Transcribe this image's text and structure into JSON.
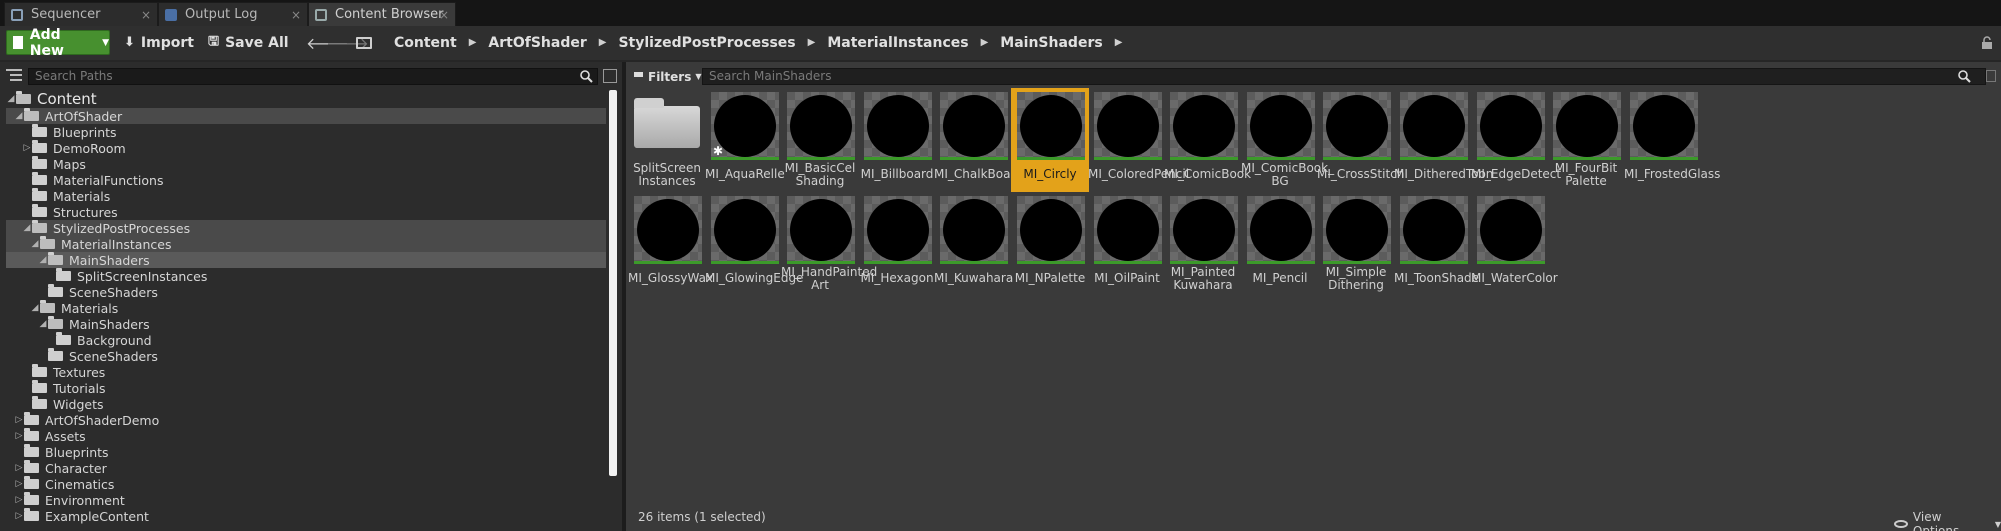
{
  "tabs": [
    {
      "label": "Sequencer",
      "icon": "sequencer-icon"
    },
    {
      "label": "Output Log",
      "icon": "output-log-icon"
    },
    {
      "label": "Content Browser",
      "icon": "content-browser-icon",
      "active": true
    }
  ],
  "toolbar": {
    "add_new": "Add New",
    "import": "Import",
    "save_all": "Save All",
    "breadcrumbs": [
      "Content",
      "ArtOfShader",
      "StylizedPostProcesses",
      "MaterialInstances",
      "MainShaders"
    ]
  },
  "sidebar": {
    "search_placeholder": "Search Paths",
    "tree": [
      {
        "label": "Content",
        "depth": 0,
        "expander": "open",
        "root": true
      },
      {
        "label": "ArtOfShader",
        "depth": 1,
        "expander": "open",
        "highlight": true
      },
      {
        "label": "Blueprints",
        "depth": 2,
        "expander": ""
      },
      {
        "label": "DemoRoom",
        "depth": 2,
        "expander": "closed"
      },
      {
        "label": "Maps",
        "depth": 2,
        "expander": ""
      },
      {
        "label": "MaterialFunctions",
        "depth": 2,
        "expander": ""
      },
      {
        "label": "Materials",
        "depth": 2,
        "expander": ""
      },
      {
        "label": "Structures",
        "depth": 2,
        "expander": ""
      },
      {
        "label": "StylizedPostProcesses",
        "depth": 2,
        "expander": "open",
        "highlight": true
      },
      {
        "label": "MaterialInstances",
        "depth": 3,
        "expander": "open",
        "highlight": true
      },
      {
        "label": "MainShaders",
        "depth": 4,
        "expander": "open",
        "selected": true
      },
      {
        "label": "SplitScreenInstances",
        "depth": 5,
        "expander": ""
      },
      {
        "label": "SceneShaders",
        "depth": 4,
        "expander": ""
      },
      {
        "label": "Materials",
        "depth": 3,
        "expander": "open"
      },
      {
        "label": "MainShaders",
        "depth": 4,
        "expander": "open"
      },
      {
        "label": "Background",
        "depth": 5,
        "expander": ""
      },
      {
        "label": "SceneShaders",
        "depth": 4,
        "expander": ""
      },
      {
        "label": "Textures",
        "depth": 2,
        "expander": ""
      },
      {
        "label": "Tutorials",
        "depth": 2,
        "expander": ""
      },
      {
        "label": "Widgets",
        "depth": 2,
        "expander": ""
      },
      {
        "label": "ArtOfShaderDemo",
        "depth": 1,
        "expander": "closed"
      },
      {
        "label": "Assets",
        "depth": 1,
        "expander": "closed"
      },
      {
        "label": "Blueprints",
        "depth": 1,
        "expander": ""
      },
      {
        "label": "Character",
        "depth": 1,
        "expander": "closed"
      },
      {
        "label": "Cinematics",
        "depth": 1,
        "expander": "closed"
      },
      {
        "label": "Environment",
        "depth": 1,
        "expander": "closed"
      },
      {
        "label": "ExampleContent",
        "depth": 1,
        "expander": "closed"
      }
    ]
  },
  "main": {
    "filters_label": "Filters",
    "search_placeholder": "Search MainShaders",
    "assets": [
      {
        "label": "SplitScreen\nInstances",
        "kind": "folder"
      },
      {
        "label": "MI_AquaRelle",
        "kind": "material",
        "starred": true
      },
      {
        "label": "MI_BasicCel\nShading",
        "kind": "material"
      },
      {
        "label": "MI_Billboard",
        "kind": "material"
      },
      {
        "label": "MI_ChalkBoard",
        "kind": "material"
      },
      {
        "label": "MI_Circly",
        "kind": "material",
        "selected": true
      },
      {
        "label": "MI_ColoredPencil",
        "kind": "material"
      },
      {
        "label": "MI_ComicBook",
        "kind": "material"
      },
      {
        "label": "MI_ComicBook_\nBG",
        "kind": "material"
      },
      {
        "label": "MI_CrossStitch",
        "kind": "material"
      },
      {
        "label": "MI_DitheredToon",
        "kind": "material"
      },
      {
        "label": "MI_EdgeDetect",
        "kind": "material"
      },
      {
        "label": "MI_FourBit\nPalette",
        "kind": "material"
      },
      {
        "label": "MI_FrostedGlass",
        "kind": "material"
      },
      {
        "label": "MI_GlossyWax",
        "kind": "material"
      },
      {
        "label": "MI_GlowingEdge",
        "kind": "material"
      },
      {
        "label": "MI_HandPainted\nArt",
        "kind": "material"
      },
      {
        "label": "MI_Hexagon",
        "kind": "material"
      },
      {
        "label": "MI_Kuwahara",
        "kind": "material"
      },
      {
        "label": "MI_NPalette",
        "kind": "material"
      },
      {
        "label": "MI_OilPaint",
        "kind": "material"
      },
      {
        "label": "MI_Painted\nKuwahara",
        "kind": "material"
      },
      {
        "label": "MI_Pencil",
        "kind": "material"
      },
      {
        "label": "MI_Simple\nDithering",
        "kind": "material"
      },
      {
        "label": "MI_ToonShade",
        "kind": "material"
      },
      {
        "label": "MI_WaterColor",
        "kind": "material"
      }
    ],
    "status": "26 items (1 selected)",
    "view_options": "View Options"
  },
  "colors": {
    "add_new_green": "#47902f",
    "selection_orange": "#e3a21a",
    "material_underline": "#3c9a2a"
  }
}
